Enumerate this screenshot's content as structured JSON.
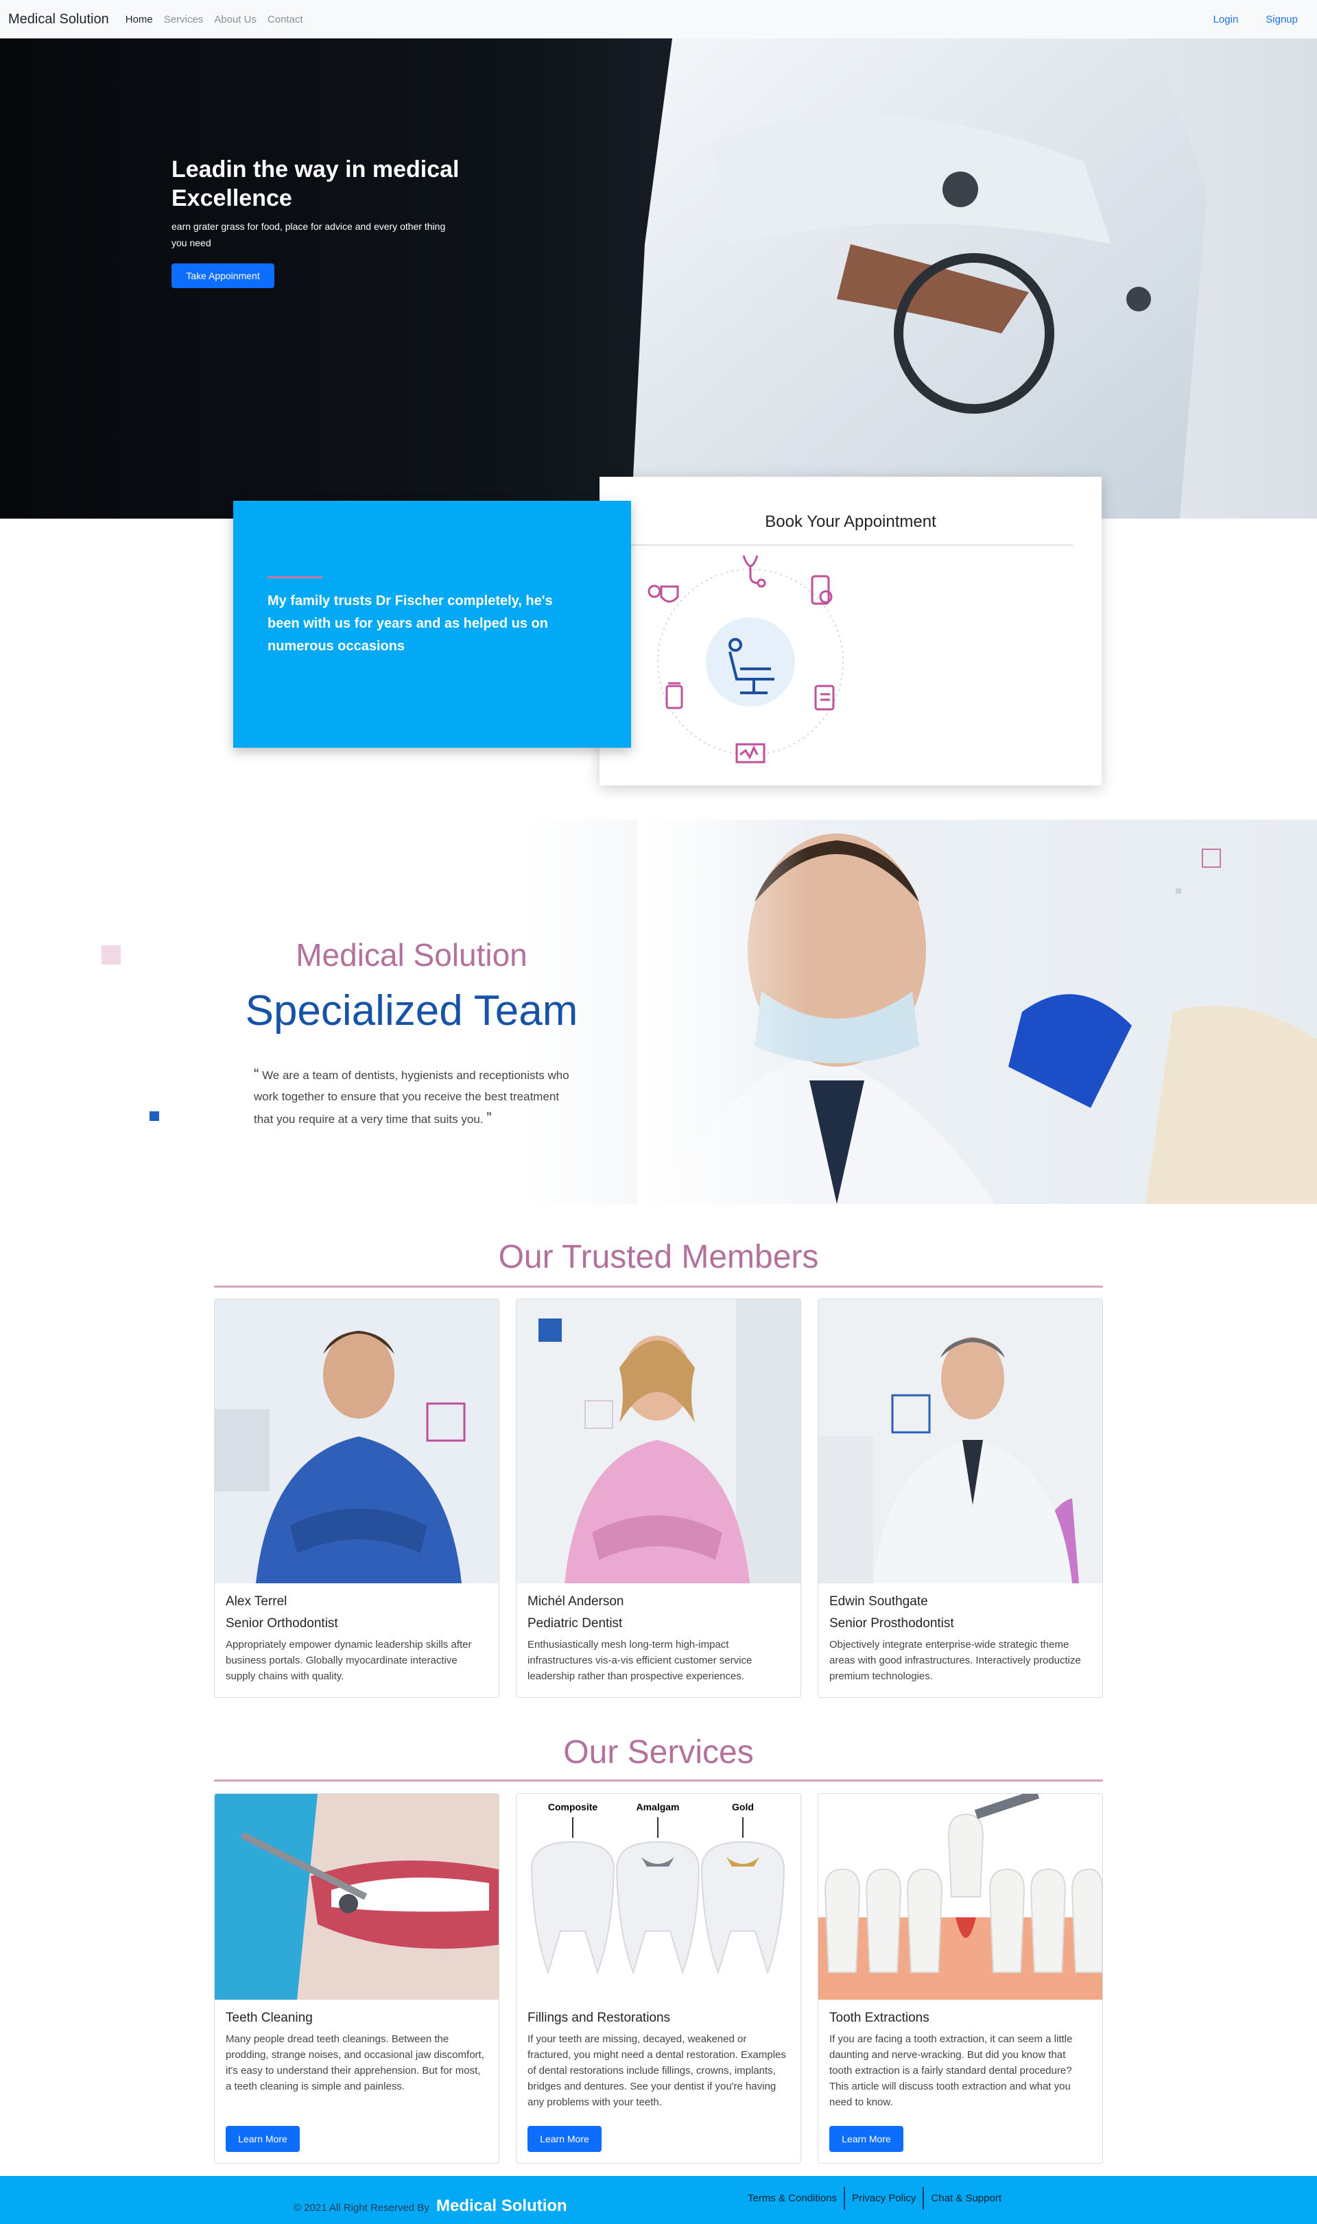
{
  "nav": {
    "brand": "Medical Solution",
    "links": [
      "Home",
      "Services",
      "About Us",
      "Contact"
    ],
    "login": "Login",
    "signup": "Signup"
  },
  "hero": {
    "title": "Leadin the way in medical Excellence",
    "subtitle": "earn grater grass for food, place for advice and every other thing you need",
    "button": "Take Appoinment"
  },
  "quote_card": {
    "text": "My family trusts Dr Fischer completely, he's been with us for years and as helped us on numerous occasions"
  },
  "booking": {
    "title": "Book Your Appointment"
  },
  "specialized": {
    "subtitle": "Medical Solution",
    "title": "Specialized Team",
    "quote": "We are a team of dentists, hygienists and receptionists who work together to ensure that you receive the best treatment that you require at a very time that suits you."
  },
  "members": {
    "title": "Our Trusted Members",
    "items": [
      {
        "name": "Alex Terrel",
        "role": "Senior Orthodontist",
        "desc": "Appropriately empower dynamic leadership skills after business portals. Globally myocardinate interactive supply chains with quality."
      },
      {
        "name": "Michél Anderson",
        "role": "Pediatric Dentist",
        "desc": "Enthusiastically mesh long-term high-impact infrastructures vis-a-vis efficient customer service leadership rather than prospective experiences."
      },
      {
        "name": "Edwin Southgate",
        "role": "Senior Prosthodontist",
        "desc": "Objectively integrate enterprise-wide strategic theme areas with good infrastructures. Interactively productize premium technologies."
      }
    ]
  },
  "services": {
    "title": "Our Services",
    "image_labels": [
      "Composite",
      "Amalgam",
      "Gold"
    ],
    "items": [
      {
        "title": "Teeth Cleaning",
        "desc": "Many people dread teeth cleanings. Between the prodding, strange noises, and occasional jaw discomfort, it's easy to understand their apprehension. But for most, a teeth cleaning is simple and painless.",
        "button": "Learn More"
      },
      {
        "title": "Fillings and Restorations",
        "desc": "If your teeth are missing, decayed, weakened or fractured, you might need a dental restoration. Examples of dental restorations include fillings, crowns, implants, bridges and dentures. See your dentist if you're having any problems with your teeth.",
        "button": "Learn More"
      },
      {
        "title": "Tooth Extractions",
        "desc": "If you are facing a tooth extraction, it can seem a little daunting and nerve-wracking. But did you know that tooth extraction is a fairly standard dental procedure? This article will discuss tooth extraction and what you need to know.",
        "button": "Learn More"
      }
    ]
  },
  "footer": {
    "copyright": "© 2021 All Right Reserved By",
    "brand": "Medical Solution",
    "links": [
      "Terms & Conditions",
      "Privacy Policy",
      "Chat & Support"
    ]
  },
  "colors": {
    "primary": "#0d6efd",
    "accent_blue": "#03a9f4",
    "pink": "#b3719b",
    "navy": "#1652a8"
  }
}
